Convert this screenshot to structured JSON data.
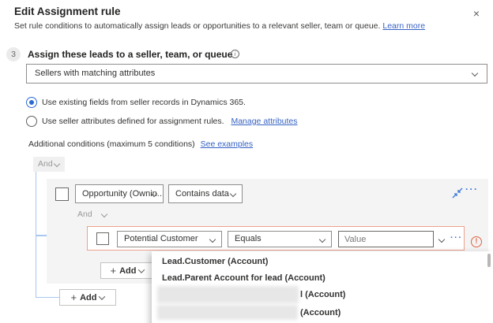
{
  "dialog": {
    "title": "Edit Assignment rule",
    "subtitle": "Set rule conditions to automatically assign leads or opportunities to a relevant seller, team or queue.",
    "learn_more_label": "Learn more"
  },
  "step": {
    "number": "3",
    "heading": "Assign these leads to a seller, team, or queue"
  },
  "select": {
    "value": "Sellers with matching attributes"
  },
  "radio_options": [
    {
      "label": "Use existing fields from seller records in Dynamics 365.",
      "selected": true
    },
    {
      "label": "Use seller attributes defined for assignment rules.",
      "selected": false,
      "link_label": "Manage attributes"
    }
  ],
  "conditions": {
    "intro": "Additional conditions (maximum 5 conditions)",
    "examples_link": "See examples"
  },
  "tree": {
    "outer_operator": "And",
    "outer_add_label": "Add",
    "group": {
      "field": "Opportunity (Ownin...",
      "operator": "Contains data",
      "inner_operator": "And",
      "add_label": "Add",
      "row": {
        "field": "Potential Customer",
        "operator": "Equals",
        "value_placeholder": "Value",
        "has_error": true
      }
    }
  },
  "flyout": {
    "items": [
      {
        "label": "Lead.Customer (Account)",
        "redacted": false
      },
      {
        "label": "Lead.Parent Account for lead (Account)",
        "redacted": false
      },
      {
        "label": "l (Account)",
        "redacted": true
      },
      {
        "label": "(Account)",
        "redacted": true
      }
    ]
  },
  "icons": {
    "close": "×",
    "info": "i",
    "error": "!",
    "plus": "+",
    "more": "···"
  },
  "colors": {
    "accent_blue": "#2b6bd0",
    "link_blue": "#3662c4",
    "icon_blue": "#3b78d4",
    "error_border": "#eda28c",
    "error_icon": "#dd6243",
    "tree_line": "#a9c7f0",
    "group_background": "#f4f4f4"
  }
}
